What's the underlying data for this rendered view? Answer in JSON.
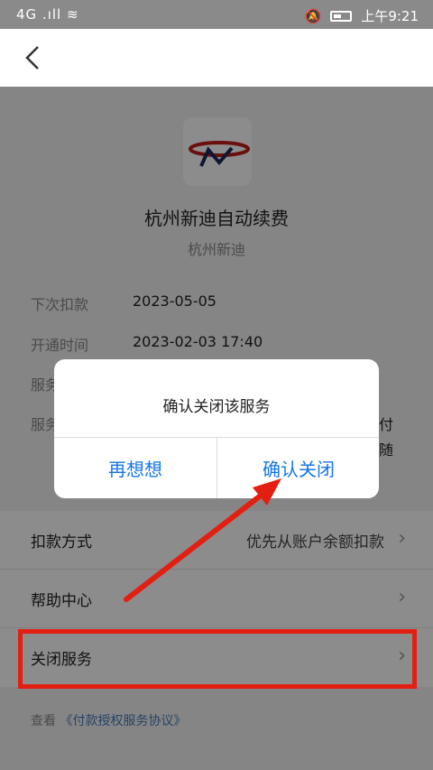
{
  "status_bar": {
    "left": "4G .ıll ≋",
    "time": "上午9:21"
  },
  "nav": {
    "back_icon": "back-chevron"
  },
  "merchant": {
    "title": "杭州新迪自动续费",
    "subtitle": "杭州新迪"
  },
  "info": [
    {
      "label": "下次扣款",
      "value": "2023-05-05"
    },
    {
      "label": "开通时间",
      "value": "2023-02-03 17:40"
    },
    {
      "label": "服务",
      "value": ""
    },
    {
      "label": "服务",
      "value": "付\n随"
    }
  ],
  "menu": {
    "payment_method": {
      "label": "扣款方式",
      "value": "优先从账户余额扣款"
    },
    "help_center": {
      "label": "帮助中心"
    },
    "close_service": {
      "label": "关闭服务"
    }
  },
  "agreement": {
    "prefix": "查看",
    "link": "《付款授权服务协议》"
  },
  "dialog": {
    "message": "确认关闭该服务",
    "cancel_label": "再想想",
    "confirm_label": "确认关闭"
  },
  "colors": {
    "accent": "#1676e6",
    "highlight": "#e31f11",
    "overlay": "rgba(0,0,0,0.45)"
  }
}
